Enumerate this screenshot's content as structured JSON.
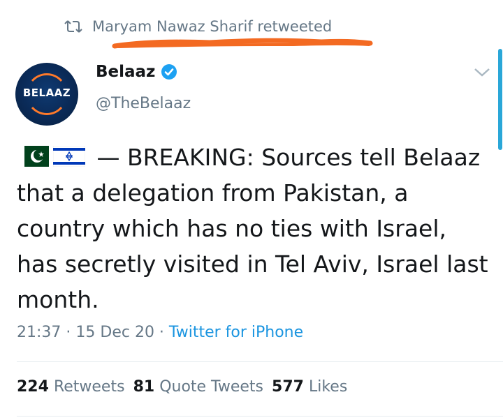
{
  "retweet": {
    "label": "Maryam Nawaz Sharif retweeted"
  },
  "author": {
    "display_name": "Belaaz",
    "handle": "@TheBelaaz",
    "avatar_text": "BELAAZ",
    "verified": true
  },
  "tweet": {
    "flags": [
      "flag-pakistan-icon",
      "flag-israel-icon"
    ],
    "text": " — BREAKING: Sources tell Belaaz that a delegation from Pakistan, a country which has no ties with Israel, has secretly visited in Tel Aviv, Israel last month.",
    "time": "21:37",
    "date": "15 Dec 20",
    "source": "Twitter for iPhone",
    "separator": " · "
  },
  "stats": {
    "retweets_count": "224",
    "retweets_label": "Retweets",
    "quotes_count": "81",
    "quotes_label": "Quote Tweets",
    "likes_count": "577",
    "likes_label": "Likes"
  },
  "colors": {
    "link": "#1b95e0",
    "secondary_text": "#657786",
    "primary_text": "#14171a",
    "scribble": "#f36a22",
    "verified": "#1da1f2"
  }
}
